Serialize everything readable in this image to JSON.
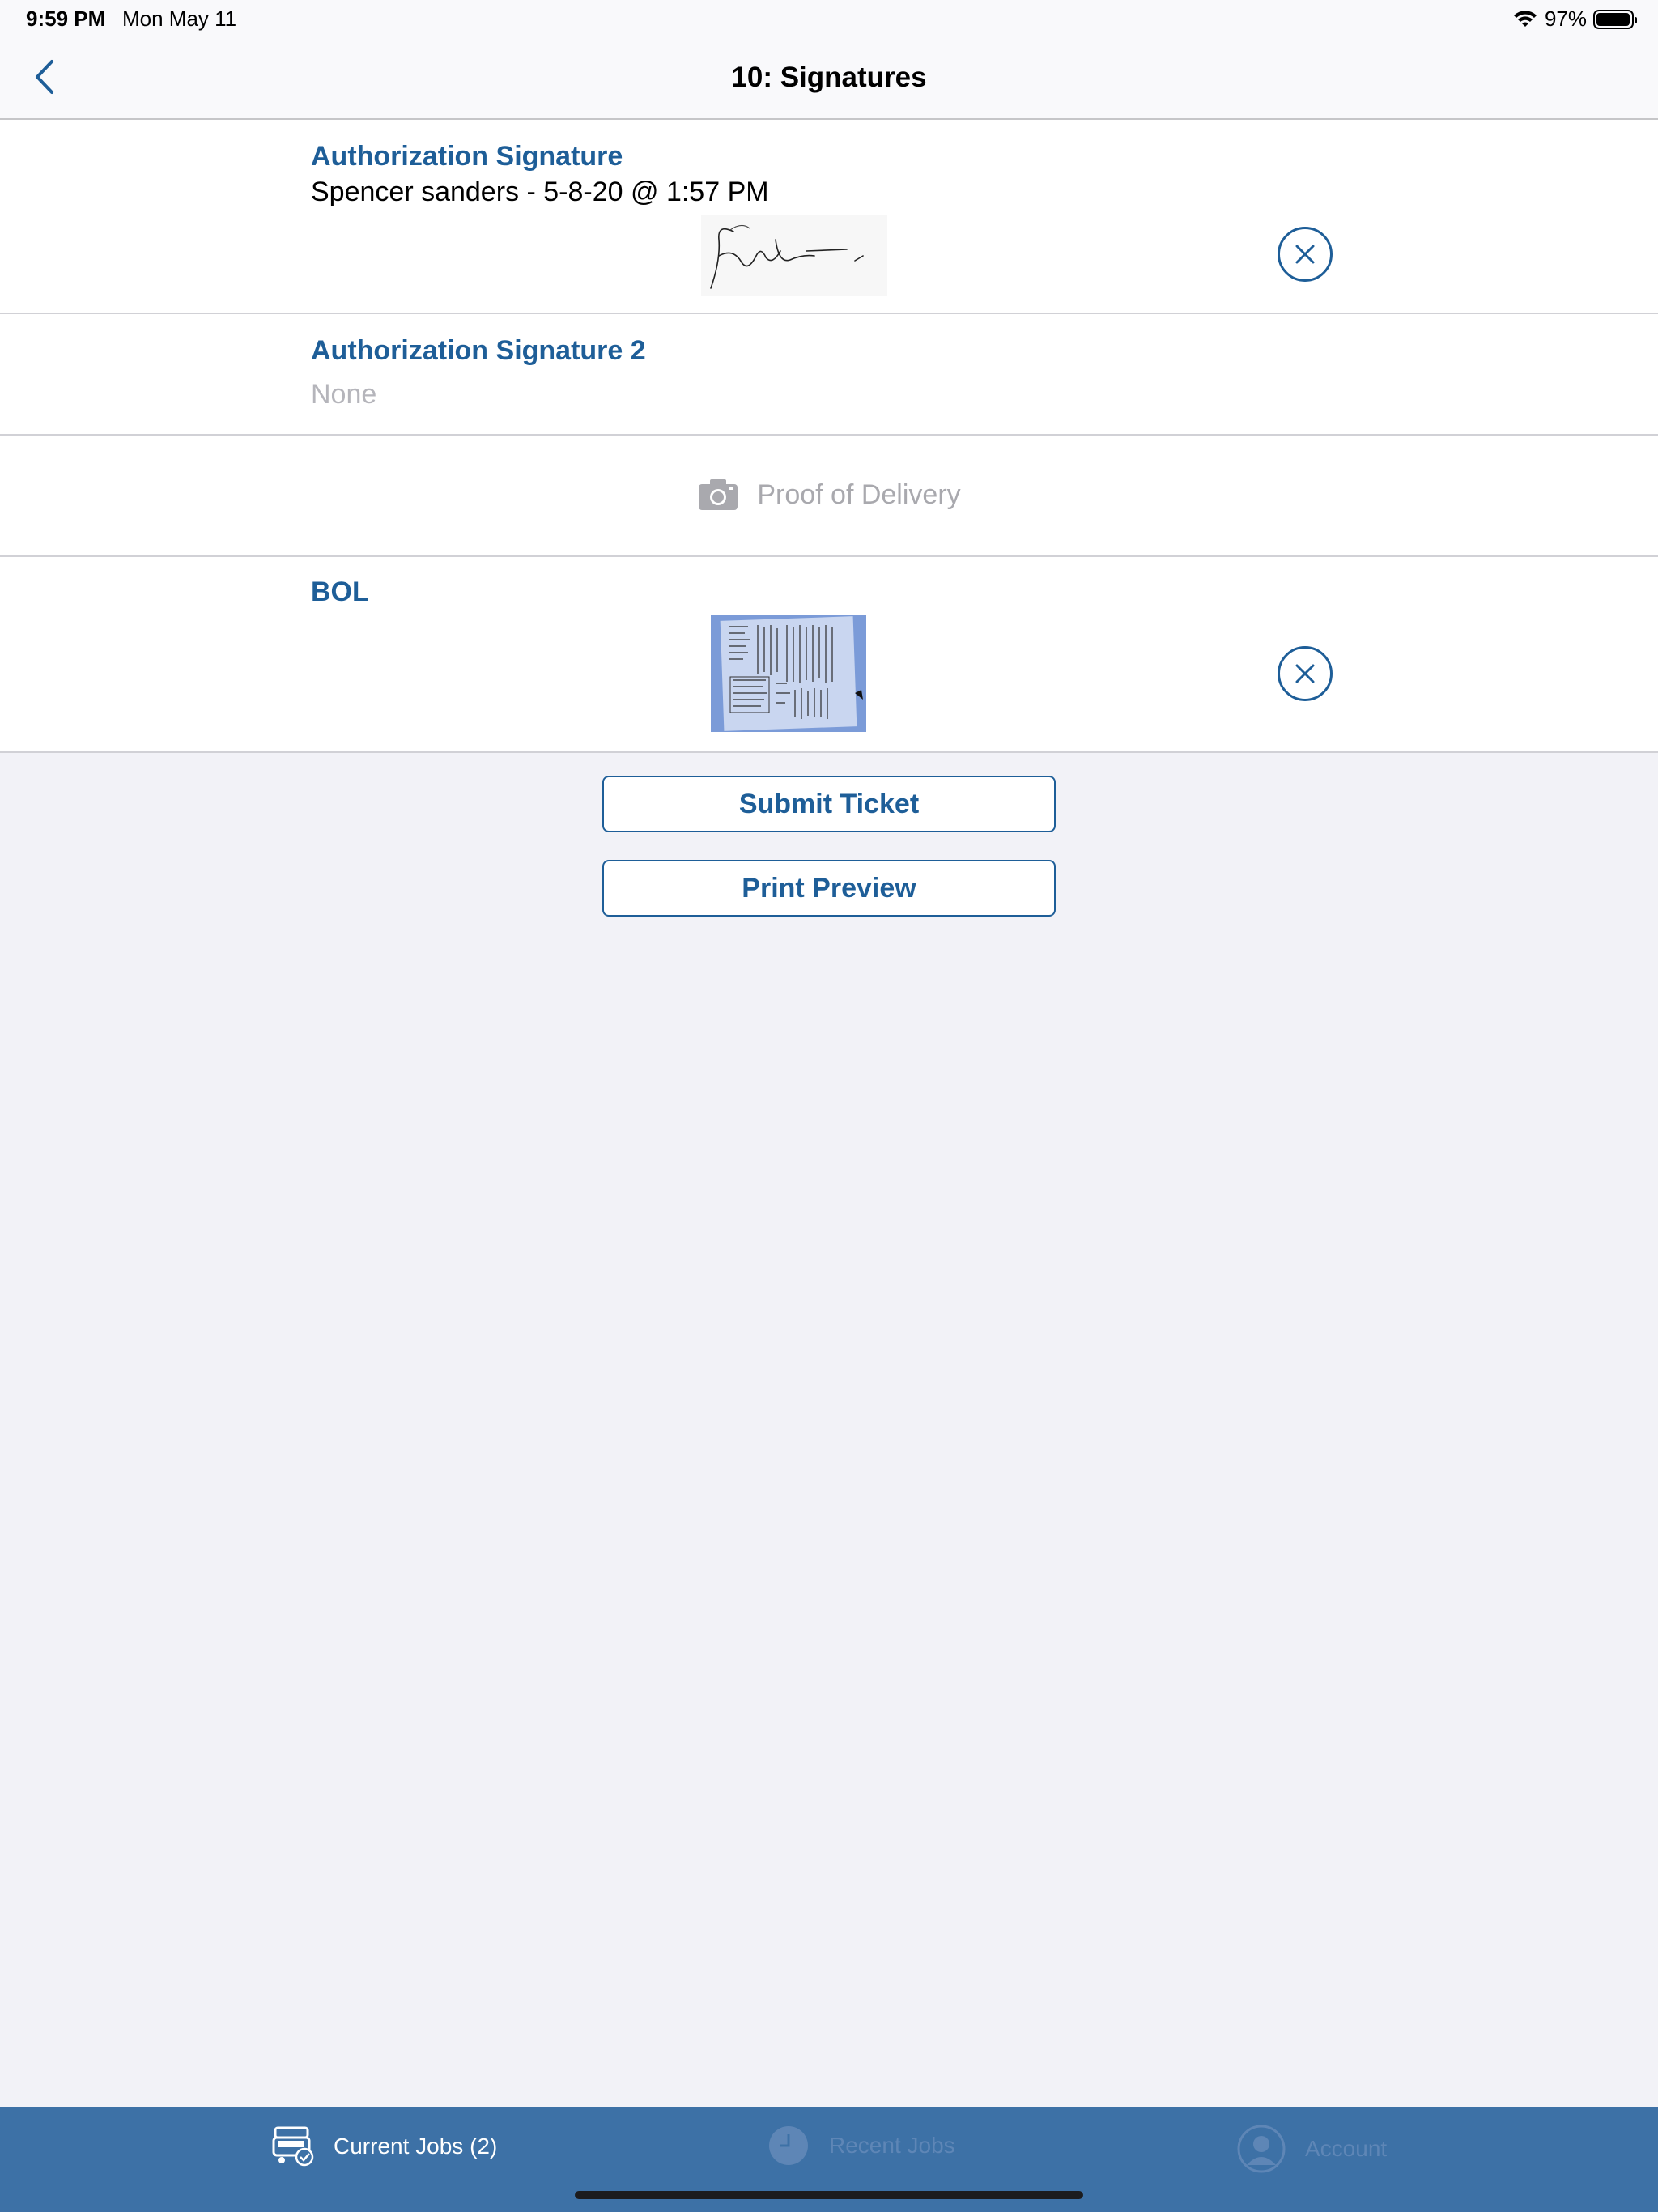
{
  "status_bar": {
    "time": "9:59 PM",
    "date": "Mon May 11",
    "battery": "97%",
    "battery_level": 0.97
  },
  "nav": {
    "title": "10: Signatures",
    "back_icon": "chevron-left-icon"
  },
  "sections": {
    "auth_signature": {
      "label": "Authorization Signature",
      "signer": "Spencer sanders - 5-8-20 @ 1:57 PM"
    },
    "auth_signature_2": {
      "label": "Authorization Signature 2",
      "value": "None"
    },
    "proof_of_delivery": {
      "label": "Proof of Delivery",
      "icon": "camera-icon"
    },
    "bol": {
      "label": "BOL"
    }
  },
  "actions": {
    "submit_label": "Submit Ticket",
    "print_label": "Print Preview"
  },
  "tab_bar": {
    "current_jobs": "Current Jobs (2)",
    "recent_jobs": "Recent Jobs",
    "account": "Account"
  },
  "colors": {
    "accent": "#1e5e98",
    "tab_bar": "#3d71a6",
    "background": "#f2f2f7"
  }
}
